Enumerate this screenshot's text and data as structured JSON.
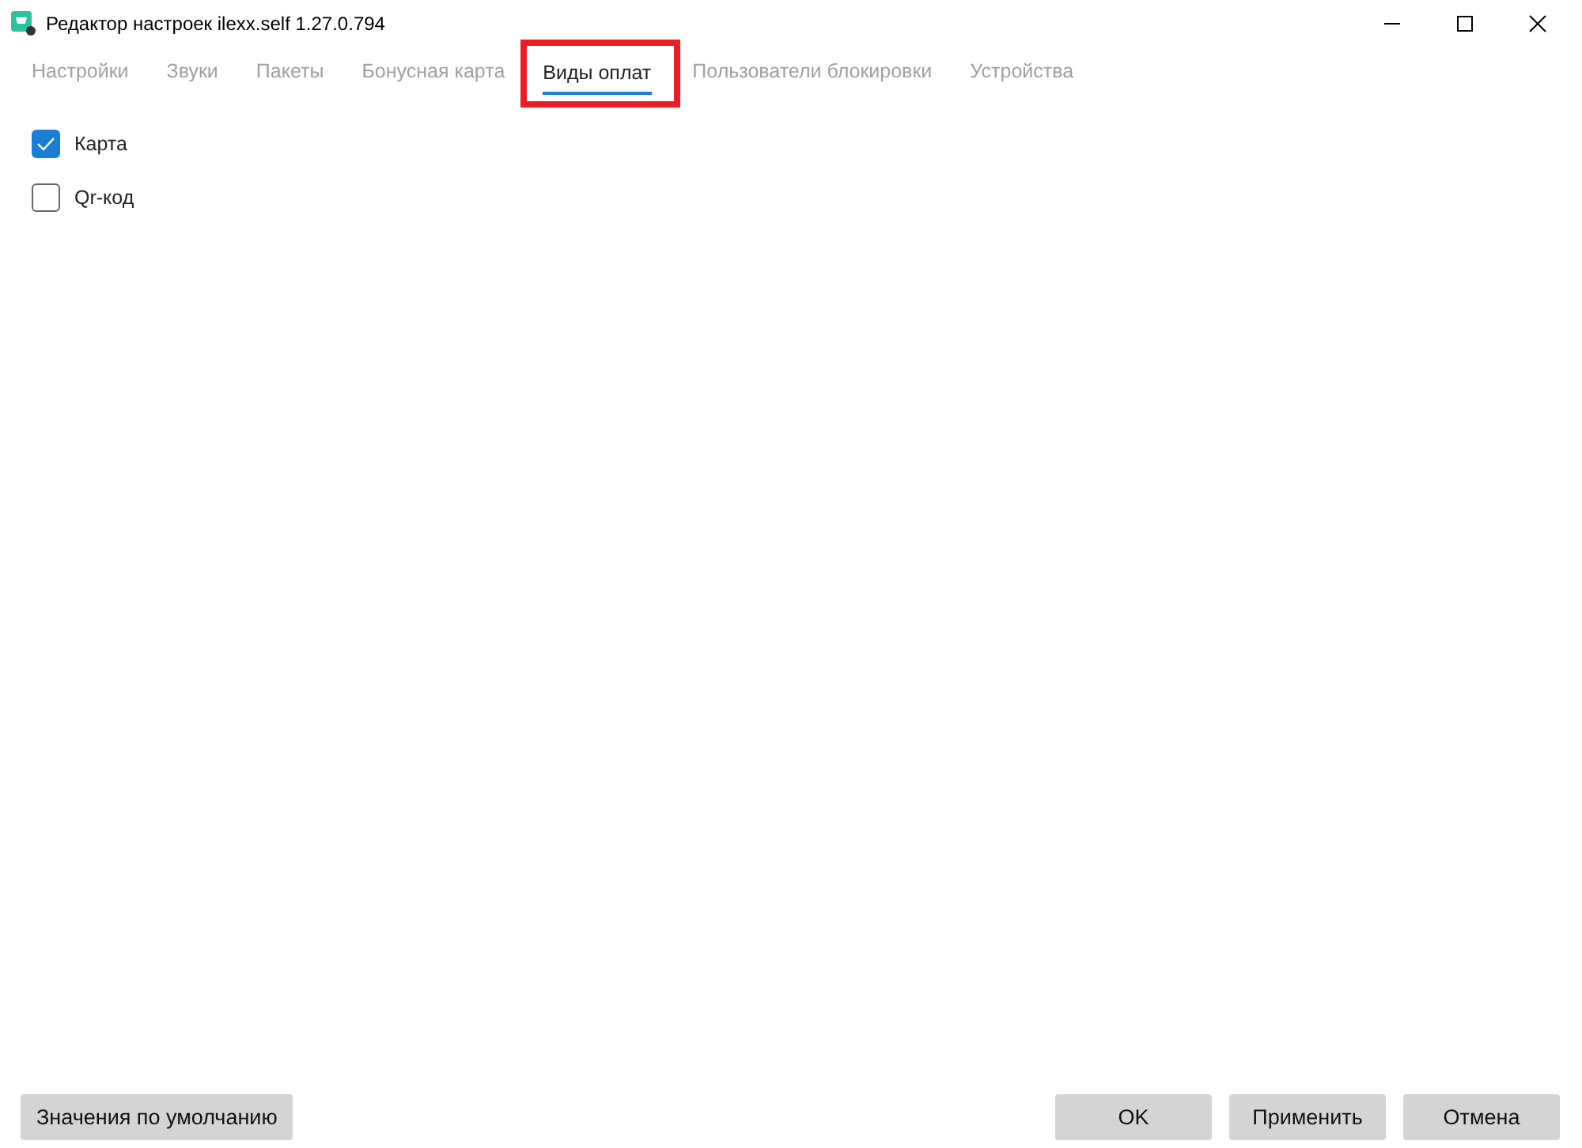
{
  "window": {
    "title": "Редактор настроек ilexx.self 1.27.0.794"
  },
  "tabs": [
    {
      "label": "Настройки",
      "selected": false,
      "highlighted": false
    },
    {
      "label": "Звуки",
      "selected": false,
      "highlighted": false
    },
    {
      "label": "Пакеты",
      "selected": false,
      "highlighted": false
    },
    {
      "label": "Бонусная карта",
      "selected": false,
      "highlighted": false
    },
    {
      "label": "Виды оплат",
      "selected": true,
      "highlighted": true
    },
    {
      "label": "Пользователи блокировки",
      "selected": false,
      "highlighted": false
    },
    {
      "label": "Устройства",
      "selected": false,
      "highlighted": false
    }
  ],
  "options": [
    {
      "label": "Карта",
      "checked": true
    },
    {
      "label": "Qr-код",
      "checked": false
    }
  ],
  "buttons_left": [
    "Значения по умолчанию"
  ],
  "buttons_right": [
    "OK",
    "Применить",
    "Отмена"
  ]
}
